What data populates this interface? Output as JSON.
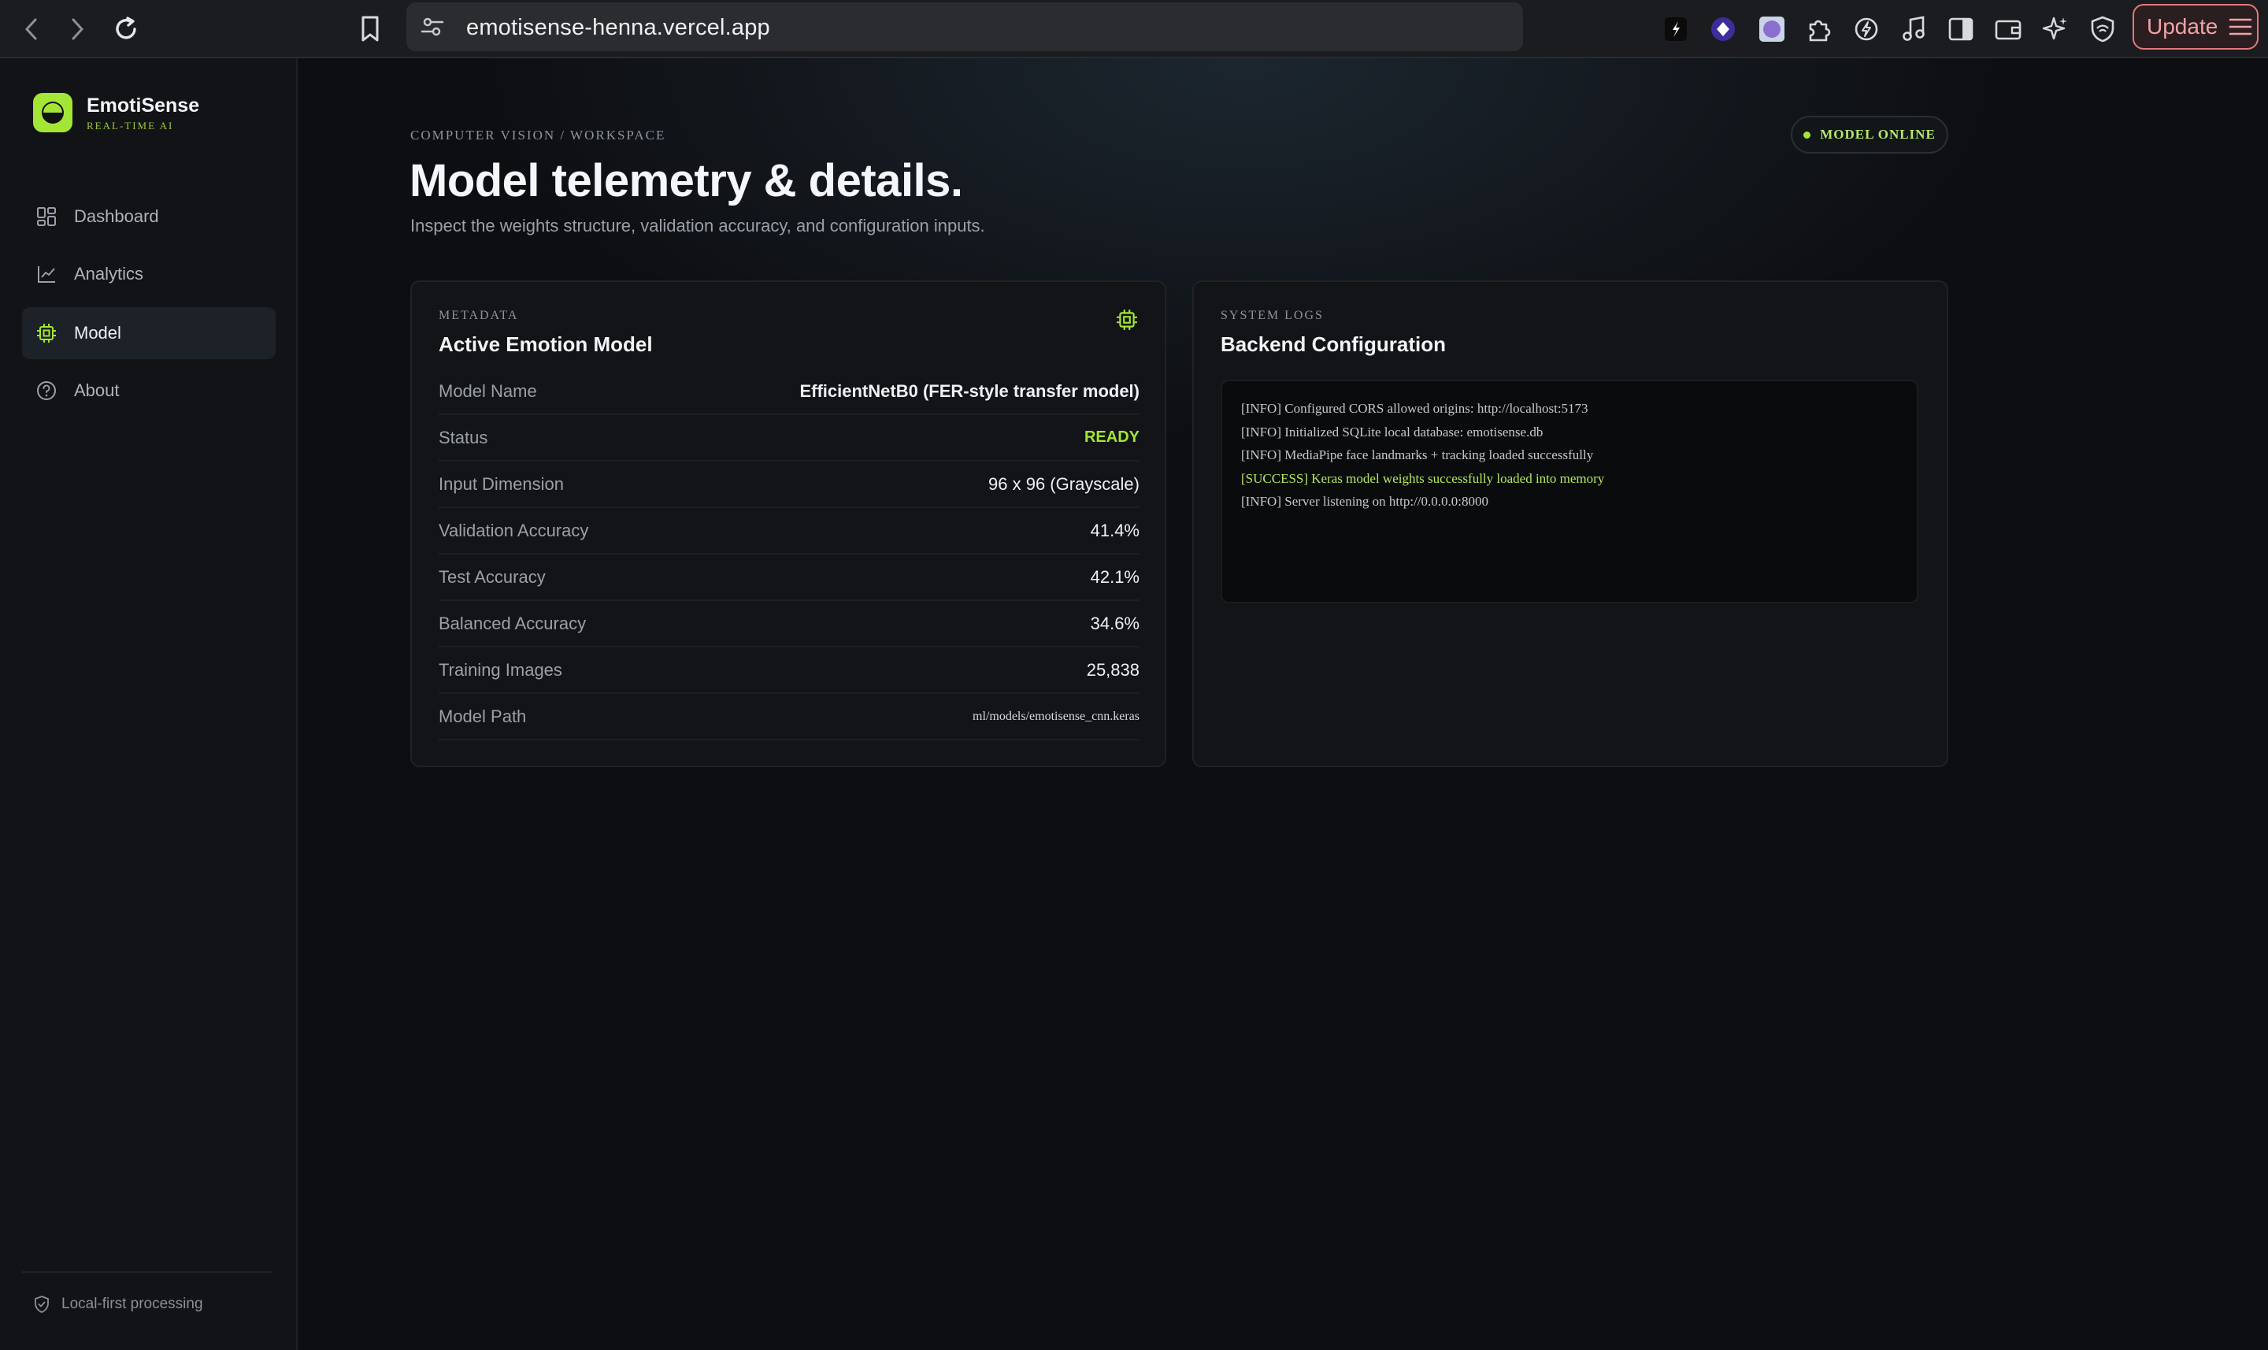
{
  "browser": {
    "url": "emotisense-henna.vercel.app",
    "update_label": "Update"
  },
  "sidebar": {
    "brand_name": "EmotiSense",
    "brand_sub": "REAL-TIME AI",
    "items": [
      {
        "label": "Dashboard",
        "icon": "dashboard-icon",
        "active": false
      },
      {
        "label": "Analytics",
        "icon": "analytics-icon",
        "active": false
      },
      {
        "label": "Model",
        "icon": "chip-icon",
        "active": true
      },
      {
        "label": "About",
        "icon": "help-icon",
        "active": false
      }
    ],
    "footer": "Local-first processing"
  },
  "header": {
    "breadcrumb": "COMPUTER VISION / WORKSPACE",
    "title": "Model telemetry & details.",
    "subtitle": "Inspect the weights structure, validation accuracy, and configuration inputs.",
    "status": "MODEL ONLINE"
  },
  "metadata_card": {
    "eyebrow": "METADATA",
    "title": "Active Emotion Model",
    "rows": [
      {
        "key": "Model Name",
        "value": "EfficientNetB0 (FER-style transfer model)"
      },
      {
        "key": "Status",
        "value": "READY"
      },
      {
        "key": "Input Dimension",
        "value": "96 x 96 (Grayscale)"
      },
      {
        "key": "Validation Accuracy",
        "value": "41.4%"
      },
      {
        "key": "Test Accuracy",
        "value": "42.1%"
      },
      {
        "key": "Balanced Accuracy",
        "value": "34.6%"
      },
      {
        "key": "Training Images",
        "value": "25,838"
      },
      {
        "key": "Model Path",
        "value": "ml/models/emotisense_cnn.keras"
      }
    ]
  },
  "logs_card": {
    "eyebrow": "SYSTEM LOGS",
    "title": "Backend Configuration",
    "lines": [
      "[INFO] Configured CORS allowed origins: http://localhost:5173",
      "[INFO] Initialized SQLite local database: emotisense.db",
      "[INFO] MediaPipe face landmarks + tracking loaded successfully",
      "[SUCCESS] Keras model weights successfully loaded into memory",
      "[INFO] Server listening on http://0.0.0.0:8000"
    ]
  },
  "colors": {
    "accent": "#a3e635",
    "background": "#0d0e11"
  }
}
